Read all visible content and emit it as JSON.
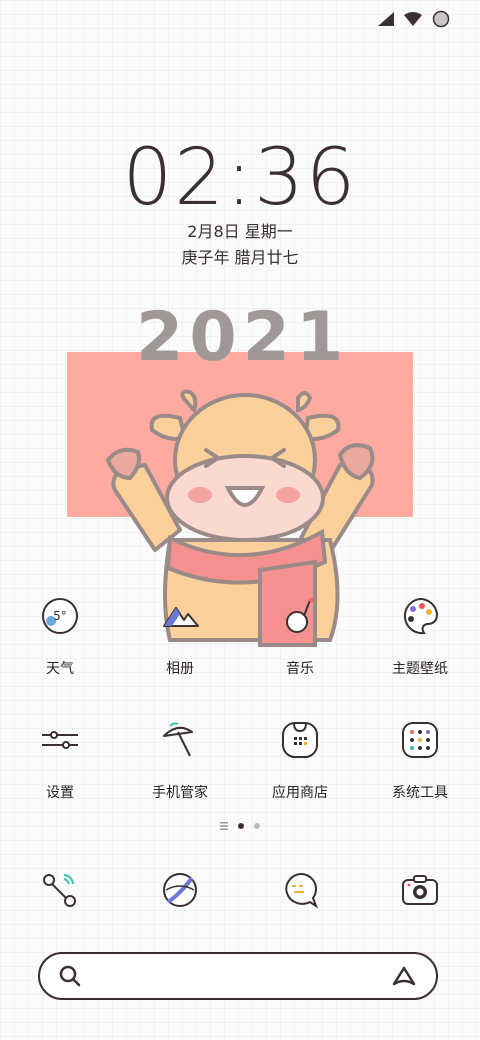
{
  "status_bar": {
    "icons": [
      "signal-icon",
      "wifi-icon",
      "battery-icon"
    ]
  },
  "lockscreen": {
    "time": "02:36",
    "date": "2月8日 星期一",
    "lunar_date": "庚子年 腊月廿七"
  },
  "wallpaper": {
    "year_text": "2021",
    "accent": "#ffaaa0"
  },
  "apps_row1": [
    {
      "label": "天气",
      "icon": "weather-icon"
    },
    {
      "label": "相册",
      "icon": "gallery-icon"
    },
    {
      "label": "音乐",
      "icon": "music-icon"
    },
    {
      "label": "主题壁纸",
      "icon": "palette-icon"
    }
  ],
  "apps_row2": [
    {
      "label": "设置",
      "icon": "settings-sliders-icon"
    },
    {
      "label": "手机管家",
      "icon": "umbrella-icon"
    },
    {
      "label": "应用商店",
      "icon": "app-store-icon"
    },
    {
      "label": "系统工具",
      "icon": "tools-icon"
    }
  ],
  "page_indicator": {
    "pages": 3,
    "current": 2
  },
  "dock": [
    {
      "icon": "phone-icon"
    },
    {
      "icon": "browser-icon"
    },
    {
      "icon": "messages-icon"
    },
    {
      "icon": "camera-icon"
    }
  ],
  "weather": {
    "temp": "5°"
  },
  "search_bar": {
    "icons": [
      "search-icon",
      "assistant-icon"
    ]
  }
}
